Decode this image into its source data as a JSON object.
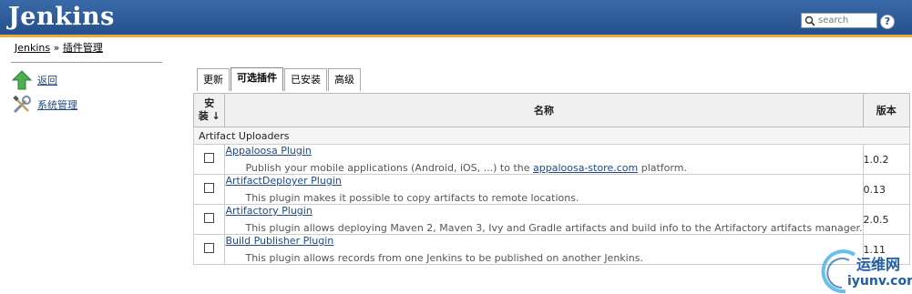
{
  "header": {
    "logo": "Jenkins",
    "search_placeholder": "search",
    "help_symbol": "?"
  },
  "breadcrumb": {
    "home": "Jenkins",
    "separator": "»",
    "current": "插件管理"
  },
  "sidebar": {
    "items": [
      {
        "label": "返回",
        "icon": "up-arrow-icon"
      },
      {
        "label": "系统管理",
        "icon": "tools-icon"
      }
    ]
  },
  "tabs": [
    {
      "label": "更新",
      "active": false
    },
    {
      "label": "可选插件",
      "active": true
    },
    {
      "label": "已安装",
      "active": false
    },
    {
      "label": "高级",
      "active": false
    }
  ],
  "table": {
    "headers": {
      "install_line1": "安",
      "install_line2": "装",
      "sort_arrow": "↓",
      "name": "名称",
      "version": "版本"
    },
    "category": "Artifact Uploaders",
    "plugins": [
      {
        "name": "Appaloosa Plugin",
        "desc_before": "Publish your mobile applications (Android, iOS, ...) to the ",
        "desc_link": "appaloosa-store.com",
        "desc_after": " platform.",
        "version": "1.0.2"
      },
      {
        "name": "ArtifactDeployer Plugin",
        "desc_before": "This plugin makes it possible to copy artifacts to remote locations.",
        "desc_link": "",
        "desc_after": "",
        "version": "0.13"
      },
      {
        "name": "Artifactory Plugin",
        "desc_before": "This plugin allows deploying Maven 2, Maven 3, Ivy and Gradle artifacts and build info to the Artifactory artifacts manager.",
        "desc_link": "",
        "desc_after": "",
        "version": "2.0.5"
      },
      {
        "name": "Build Publisher Plugin",
        "desc_before": "This plugin allows records from one Jenkins to be published on another Jenkins.",
        "desc_link": "",
        "desc_after": "",
        "version": "1.11"
      }
    ]
  },
  "watermark": {
    "top": "运维网",
    "bottom": "iyunv.com"
  },
  "colors": {
    "header_bg": "#24508c",
    "header_accent": "#f0a73a",
    "link": "#204a87"
  }
}
